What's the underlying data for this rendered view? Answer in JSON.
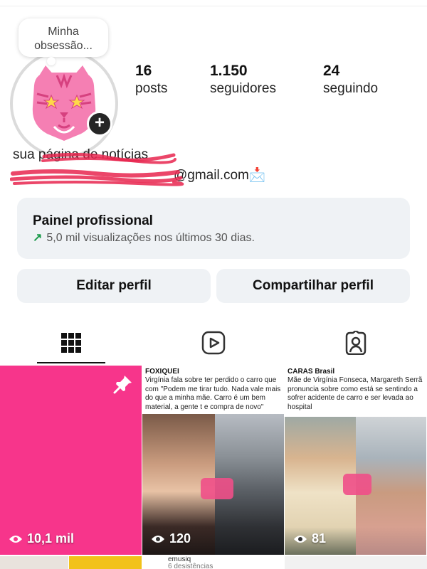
{
  "profile": {
    "note": "Minha obsessão...",
    "bio_line_1": "sua página de notícias",
    "bio_line_2": "@gmail.com",
    "email_emoji": "📩"
  },
  "stats": [
    {
      "value": "16",
      "label": "posts"
    },
    {
      "value": "1.150",
      "label": "seguidores"
    },
    {
      "value": "24",
      "label": "seguindo"
    }
  ],
  "dashboard": {
    "title": "Painel profissional",
    "arrow": "↗",
    "subtitle": "5,0 mil visualizações nos últimos 30 dias."
  },
  "buttons": {
    "edit": "Editar perfil",
    "share": "Compartilhar perfil"
  },
  "tabs": [
    {
      "icon": "grid-icon",
      "active": true
    },
    {
      "icon": "reels-icon",
      "active": false
    },
    {
      "icon": "tagged-icon",
      "active": false
    }
  ],
  "posts": [
    {
      "views": "10,1 mil",
      "pinned": true
    },
    {
      "source": "FOXIQUEI",
      "text": "Virgínia fala sobre ter perdido o carro que com \"Podem me tirar tudo. Nada vale mais do que a minha mãe. Carro é um bem material, a gente t e compra de novo\"",
      "views": "120"
    },
    {
      "source": "CARAS Brasil",
      "text": "Mãe de Virgínia Fonseca, Margareth Serrã pronuncia sobre como está se sentindo a sofrer acidente de carro e ser levada ao hospital",
      "views": "81"
    }
  ],
  "row2": {
    "handle": "emusiq",
    "sub": "6 desistências"
  },
  "colors": {
    "accent_pink": "#f7358b",
    "button_bg": "#eff2f5",
    "scribble": "#e8264f",
    "trend_green": "#1a9a4a"
  }
}
